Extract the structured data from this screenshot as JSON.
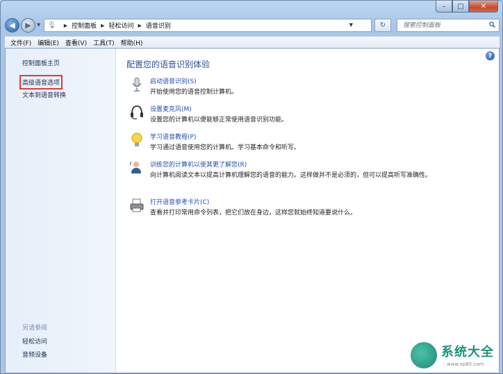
{
  "window": {
    "minimize": "–",
    "maximize": "□",
    "close": "✕"
  },
  "address": {
    "crumbs": [
      "控制面板",
      "轻松访问",
      "语音识别"
    ],
    "search_placeholder": "搜索控制面板"
  },
  "menubar": [
    "文件(F)",
    "编辑(E)",
    "查看(V)",
    "工具(T)",
    "帮助(H)"
  ],
  "sidebar": {
    "home": "控制面板主页",
    "links": [
      "高级语音选项",
      "文本到语音转换"
    ],
    "see_also_label": "另请参阅",
    "see_also": [
      "轻松访问",
      "音频设备"
    ]
  },
  "main": {
    "title": "配置您的语音识别体验",
    "tasks": [
      {
        "icon": "microphone-icon",
        "link": "启动语音识别(S)",
        "desc": "开始使用您的语音控制计算机。"
      },
      {
        "icon": "headset-icon",
        "link": "设置麦克风(M)",
        "desc": "设置您的计算机以便能够正常使用语音识别功能。"
      },
      {
        "icon": "lightbulb-icon",
        "link": "学习语音教程(P)",
        "desc": "学习通过语音使用您的计算机。学习基本命令和听写。"
      },
      {
        "icon": "user-train-icon",
        "link": "训练您的计算机以使其更了解您(R)",
        "desc": "向计算机阅读文本以提高计算机理解您的语音的能力。这样做并不是必须的，但可以提高听写准确性。"
      },
      {
        "icon": "printer-icon",
        "link": "打开语音参考卡片(C)",
        "desc": "查看并打印常用命令列表，把它们放在身边，这样您就始终知道要说什么。"
      }
    ]
  },
  "watermark": {
    "text": "系统大全",
    "url": "www.xp85.com"
  }
}
